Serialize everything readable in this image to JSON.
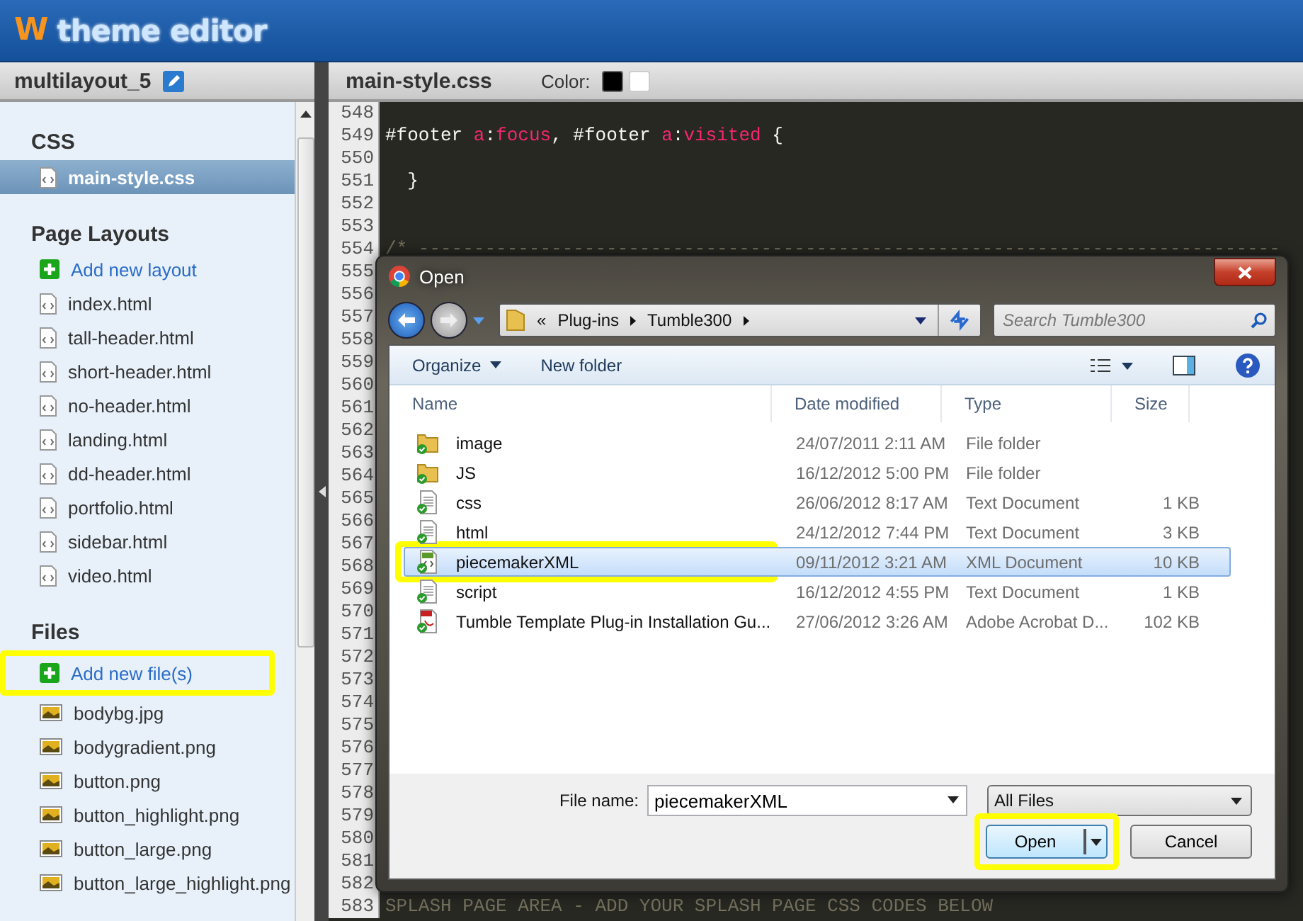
{
  "app": {
    "title": "theme editor",
    "logo": "W"
  },
  "sidebar": {
    "project": "multilayout_5",
    "sections": [
      {
        "heading": "CSS",
        "items": [
          {
            "label": "main-style.css",
            "kind": "code",
            "selected": true,
            "highlighted": false
          }
        ]
      },
      {
        "heading": "Page Layouts",
        "items": [
          {
            "label": "Add new layout",
            "kind": "add",
            "selected": false,
            "highlighted": false
          },
          {
            "label": "index.html",
            "kind": "code",
            "selected": false,
            "highlighted": false
          },
          {
            "label": "tall-header.html",
            "kind": "code",
            "selected": false,
            "highlighted": false
          },
          {
            "label": "short-header.html",
            "kind": "code",
            "selected": false,
            "highlighted": false
          },
          {
            "label": "no-header.html",
            "kind": "code",
            "selected": false,
            "highlighted": false
          },
          {
            "label": "landing.html",
            "kind": "code",
            "selected": false,
            "highlighted": false
          },
          {
            "label": "dd-header.html",
            "kind": "code",
            "selected": false,
            "highlighted": false
          },
          {
            "label": "portfolio.html",
            "kind": "code",
            "selected": false,
            "highlighted": false
          },
          {
            "label": "sidebar.html",
            "kind": "code",
            "selected": false,
            "highlighted": false
          },
          {
            "label": "video.html",
            "kind": "code",
            "selected": false,
            "highlighted": false
          }
        ]
      },
      {
        "heading": "Files",
        "items": [
          {
            "label": "Add new file(s)",
            "kind": "add",
            "selected": false,
            "highlighted": true
          },
          {
            "label": "bodybg.jpg",
            "kind": "image",
            "selected": false,
            "highlighted": false
          },
          {
            "label": "bodygradient.png",
            "kind": "image",
            "selected": false,
            "highlighted": false
          },
          {
            "label": "button.png",
            "kind": "image",
            "selected": false,
            "highlighted": false
          },
          {
            "label": "button_highlight.png",
            "kind": "image",
            "selected": false,
            "highlighted": false
          },
          {
            "label": "button_large.png",
            "kind": "image",
            "selected": false,
            "highlighted": false
          },
          {
            "label": "button_large_highlight.png",
            "kind": "image",
            "selected": false,
            "highlighted": false
          }
        ]
      }
    ]
  },
  "editor": {
    "filename": "main-style.css",
    "color_label": "Color:",
    "swatches": [
      {
        "color": "#000000",
        "selected": true
      },
      {
        "color": "#ffffff",
        "selected": false
      }
    ],
    "lines": [
      {
        "number": "548"
      },
      {
        "number": "549",
        "tokens": [
          {
            "kind": "plain",
            "text": "#footer "
          },
          {
            "kind": "keyword",
            "text": "a"
          },
          {
            "kind": "plain",
            "text": ":"
          },
          {
            "kind": "keyword",
            "text": "focus"
          },
          {
            "kind": "plain",
            "text": ", #footer "
          },
          {
            "kind": "keyword",
            "text": "a"
          },
          {
            "kind": "plain",
            "text": ":"
          },
          {
            "kind": "keyword",
            "text": "visited"
          },
          {
            "kind": "plain",
            "text": " {"
          }
        ]
      },
      {
        "number": "550"
      },
      {
        "number": "551",
        "tokens": [
          {
            "kind": "plain",
            "text": "  }"
          }
        ]
      },
      {
        "number": "552"
      },
      {
        "number": "553"
      },
      {
        "number": "554",
        "tokens": [
          {
            "kind": "comment",
            "text": "/* ------------------------------------------------------------------------------"
          }
        ]
      },
      {
        "number": "555"
      },
      {
        "number": "556"
      },
      {
        "number": "557"
      },
      {
        "number": "558"
      },
      {
        "number": "559"
      },
      {
        "number": "560"
      },
      {
        "number": "561"
      },
      {
        "number": "562"
      },
      {
        "number": "563"
      },
      {
        "number": "564"
      },
      {
        "number": "565"
      },
      {
        "number": "566"
      },
      {
        "number": "567"
      },
      {
        "number": "568"
      },
      {
        "number": "569"
      },
      {
        "number": "570"
      },
      {
        "number": "571"
      },
      {
        "number": "572"
      },
      {
        "number": "573"
      },
      {
        "number": "574"
      },
      {
        "number": "575"
      },
      {
        "number": "576"
      },
      {
        "number": "577"
      },
      {
        "number": "578"
      },
      {
        "number": "579"
      },
      {
        "number": "580"
      },
      {
        "number": "581"
      },
      {
        "number": "582"
      },
      {
        "number": "583",
        "tokens": [
          {
            "kind": "comment",
            "text": "SPLASH PAGE AREA - ADD YOUR SPLASH PAGE CSS CODES BELOW"
          }
        ]
      }
    ]
  },
  "dialog": {
    "title": "Open",
    "path_prefix": "«",
    "path": [
      "Plug-ins",
      "Tumble300"
    ],
    "search_placeholder": "Search Tumble300",
    "toolbar": {
      "organize": "Organize",
      "new_folder": "New folder"
    },
    "columns": [
      "Name",
      "Date modified",
      "Type",
      "Size"
    ],
    "files": [
      {
        "name": "image",
        "date": "24/07/2011 2:11 AM",
        "type": "File folder",
        "kind": "folder",
        "selected": false,
        "highlighted": false
      },
      {
        "name": "JS",
        "date": "16/12/2012 5:00 PM",
        "type": "File folder",
        "kind": "folder",
        "selected": false,
        "highlighted": false
      },
      {
        "name": "css",
        "date": "26/06/2012 8:17 AM",
        "type": "Text Document",
        "size": "1 KB",
        "kind": "text",
        "selected": false,
        "highlighted": false
      },
      {
        "name": "html",
        "date": "24/12/2012 7:44 PM",
        "type": "Text Document",
        "size": "3 KB",
        "kind": "text",
        "selected": false,
        "highlighted": false
      },
      {
        "name": "piecemakerXML",
        "date": "09/11/2012 3:21 AM",
        "type": "XML Document",
        "size": "10 KB",
        "kind": "xml",
        "selected": true,
        "highlighted": true
      },
      {
        "name": "script",
        "date": "16/12/2012 4:55 PM",
        "type": "Text Document",
        "size": "1 KB",
        "kind": "text",
        "selected": false,
        "highlighted": false
      },
      {
        "name": "Tumble Template Plug-in Installation Gu...",
        "date": "27/06/2012 3:26 AM",
        "type": "Adobe Acrobat D...",
        "size": "102 KB",
        "kind": "pdf",
        "selected": false,
        "highlighted": false
      }
    ],
    "filename_label": "File name:",
    "filename": "piecemakerXML",
    "filter": "All Files",
    "open_button": {
      "label": "Open",
      "highlighted": true
    },
    "cancel_button": "Cancel"
  }
}
